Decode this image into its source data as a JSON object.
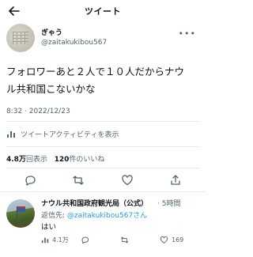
{
  "header": {
    "title": "ツイート",
    "back_icon": "arrow-left-icon"
  },
  "tweet": {
    "author_name": "ぎゃう",
    "author_handle": "@zaitakukibou567",
    "more_icon": "more-dots-icon",
    "text_line1": "フォロワーあと２人で１０人だからナウ",
    "text_line2": "ル共和国こないかな",
    "timestamp": "8:32 · 2022/12/23",
    "activity_label": "ツイートアクティビティを表示",
    "stats": {
      "views_value": "4.8万",
      "views_label": "回表示",
      "likes_value": "120",
      "likes_label": "件のいいね"
    },
    "actions": [
      "reply-icon",
      "retweet-icon",
      "like-icon",
      "share-icon"
    ]
  },
  "reply": {
    "name": "ナウル共和国政府観光局（公式）",
    "time": "· 5時間",
    "to_prefix": "返信先: ",
    "to_handle": "@zaitakukibou567",
    "to_suffix": "さん",
    "text": "はい",
    "views": "4.1万",
    "likes": "169"
  },
  "colors": {
    "text": "#0f1419",
    "secondary": "#536471",
    "link": "#1d9bf0",
    "divider": "#e7e9ea"
  }
}
